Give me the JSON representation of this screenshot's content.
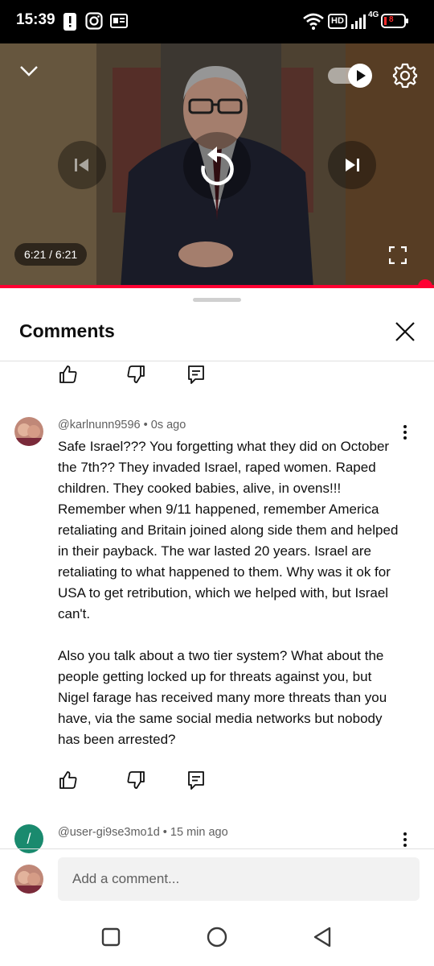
{
  "status_bar": {
    "time": "15:39",
    "notification_icons": [
      "alert-icon",
      "instagram-icon",
      "id-card-icon"
    ],
    "network_badge": "HD",
    "network_type": "4G",
    "battery_level_text": "8"
  },
  "player": {
    "time_display": "6:21 / 6:21",
    "progress_fraction": 1.0,
    "autoplay_enabled": true,
    "accent_color": "#ff0033"
  },
  "comments_panel": {
    "title": "Comments"
  },
  "comments": [
    {
      "author": "@karlnunn9596",
      "time_ago": "0s ago",
      "text": "Safe Israel??? You forgetting what they did on October the 7th?? They invaded Israel, raped women. Raped children. They cooked babies, alive, in ovens!!! Remember when 9/11 happened, remember America retaliating and Britain joined along side them and helped in their payback. The war lasted 20 years. Israel are retaliating to what happened to them. Why was it ok for USA to get retribution, which we helped with, but Israel can't.\n\nAlso you talk about a two tier system? What about the people getting locked up for threats against you, but Nigel farage has received many more threats than you have, via the same social media networks but nobody has been arrested?"
    },
    {
      "author": "@user-gi9se3mo1d",
      "time_ago": "15 min ago",
      "avatar_letter": "/",
      "avatar_color": "#1a8a6e"
    }
  ],
  "composer": {
    "placeholder": "Add a comment..."
  }
}
